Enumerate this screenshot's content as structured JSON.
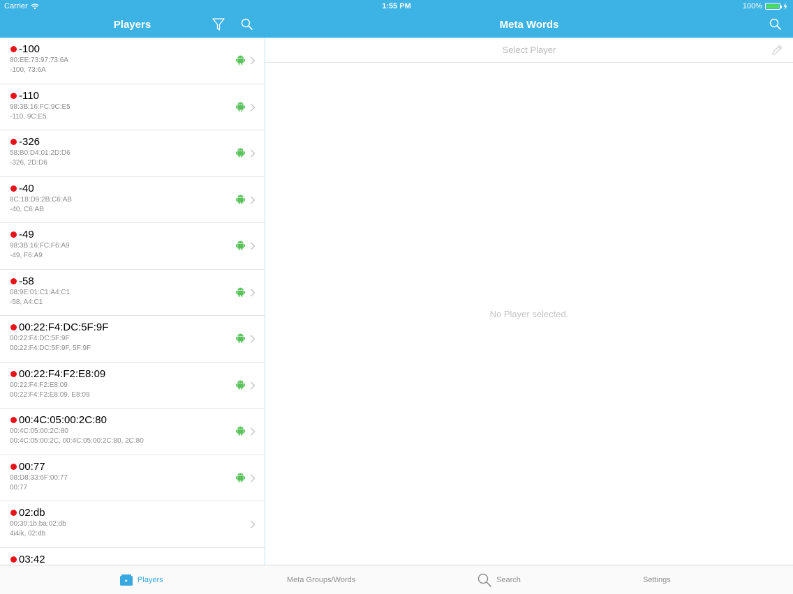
{
  "status_bar": {
    "carrier": "Carrier",
    "time": "1:55 PM",
    "battery": "100%",
    "battery_level": 1.0
  },
  "nav_left": {
    "title": "Players",
    "icons": [
      "filter-icon",
      "search-icon"
    ]
  },
  "nav_right": {
    "title": "Meta Words",
    "icons": [
      "search-icon"
    ]
  },
  "players": [
    {
      "name": "-100",
      "mac": "80:EE:73:97:73:6A",
      "aliases": "-100, 73:6A",
      "android": true
    },
    {
      "name": "-110",
      "mac": "98:3B:16:FC:9C:E5",
      "aliases": "-110, 9C:E5",
      "android": true
    },
    {
      "name": "-326",
      "mac": "58:B0:D4:01:2D:D6",
      "aliases": "-326, 2D:D6",
      "android": true
    },
    {
      "name": "-40",
      "mac": "8C:18:D9:2B:C6:AB",
      "aliases": "-40, C6:AB",
      "android": true
    },
    {
      "name": "-49",
      "mac": "98:3B:16:FC:F6:A9",
      "aliases": "-49, F6:A9",
      "android": true
    },
    {
      "name": "-58",
      "mac": "08:9E:01:C1:A4:C1",
      "aliases": "-58, A4:C1",
      "android": true
    },
    {
      "name": "00:22:F4:DC:5F:9F",
      "mac": "00:22:F4:DC:5F:9F",
      "aliases": "00:22:F4:DC:5F:9F, 5F:9F",
      "android": true
    },
    {
      "name": "00:22:F4:F2:E8:09",
      "mac": "00:22:F4:F2:E8:09",
      "aliases": "00:22:F4:F2:E8:09, E8:09",
      "android": true
    },
    {
      "name": "00:4C:05:00:2C:80",
      "mac": "00:4C:05:00:2C:80",
      "aliases": "00:4C:05:00:2C, 00:4C:05:00:2C:80, 2C:80",
      "android": true
    },
    {
      "name": "00:77",
      "mac": "08:D8:33:6F:00:77",
      "aliases": "00:77",
      "android": true
    },
    {
      "name": "02:db",
      "mac": "00:30:1b:ba:02:db",
      "aliases": "4i4ik, 02:db",
      "android": false
    },
    {
      "name": "03:42",
      "mac": "",
      "aliases": "",
      "android": false
    }
  ],
  "detail": {
    "select_label": "Select Player",
    "empty_message": "No Player selected."
  },
  "tabs": [
    {
      "label": "Players",
      "icon": "players-icon",
      "active": true
    },
    {
      "label": "Meta Groups/Words",
      "icon": "",
      "active": false
    },
    {
      "label": "Search",
      "icon": "search-icon",
      "active": false
    },
    {
      "label": "Settings",
      "icon": "",
      "active": false
    }
  ],
  "colors": {
    "header": "#3db3e5",
    "status_dot": "#e5141b",
    "android": "#5bc25b",
    "active_tab": "#3aa8e0",
    "battery": "#4cd964"
  }
}
